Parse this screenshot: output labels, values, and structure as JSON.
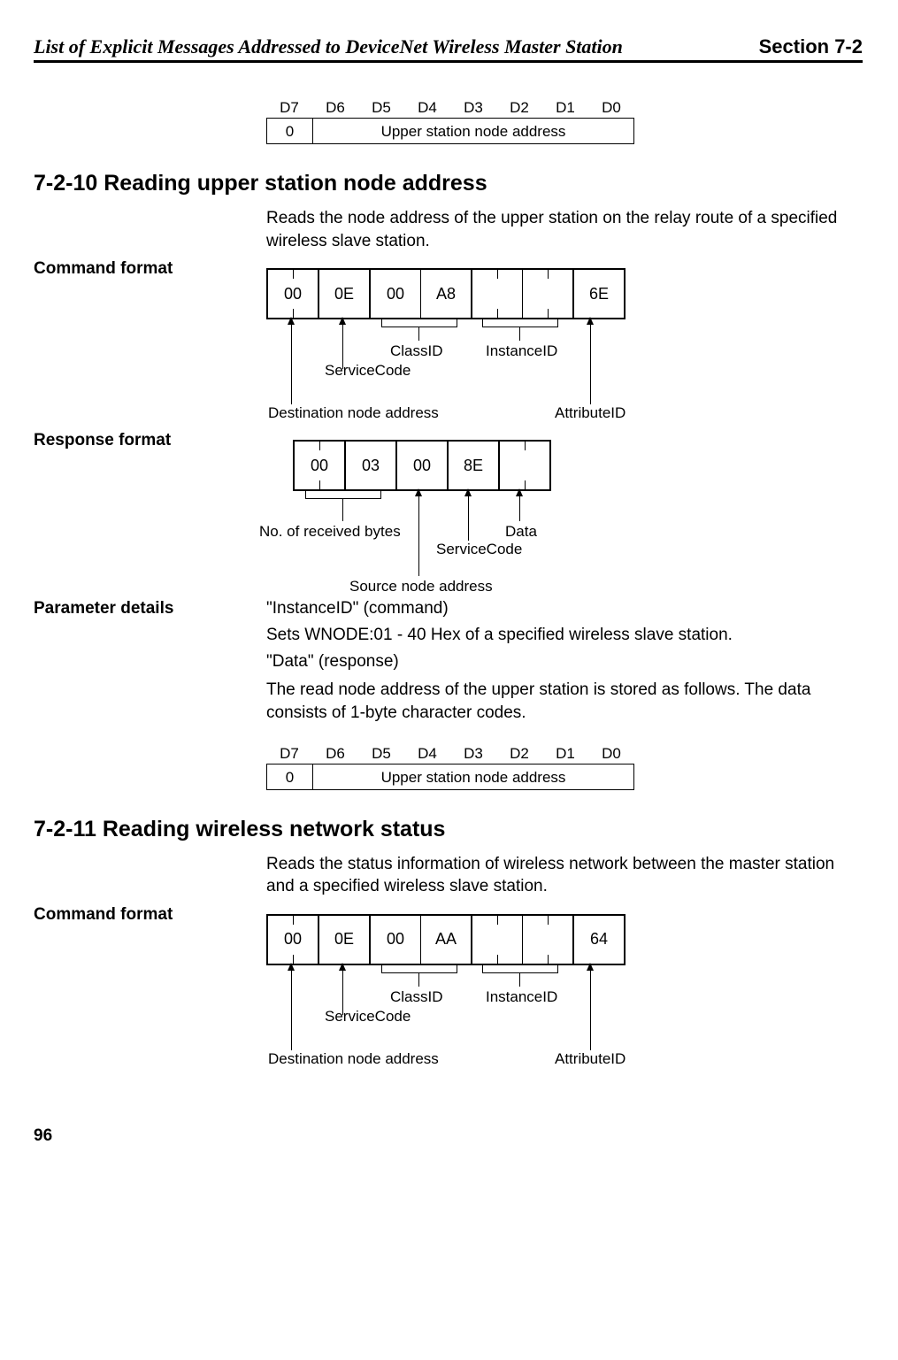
{
  "header": {
    "title": "List of Explicit Messages Addressed to DeviceNet Wireless Master Station",
    "section": "Section 7-2"
  },
  "bits": {
    "labels": [
      "D7",
      "D6",
      "D5",
      "D4",
      "D3",
      "D2",
      "D1",
      "D0"
    ],
    "zero": "0",
    "upper": "Upper station node address"
  },
  "sec10": {
    "heading": "7-2-10   Reading upper station node address",
    "intro": "Reads the node address of the upper station on the relay route of a specified wireless slave station.",
    "cmd_label": "Command format",
    "cmd_cells": [
      "00",
      "0E",
      "00",
      "A8",
      "",
      "",
      "6E"
    ],
    "cmd_lbls": {
      "dest": "Destination node address",
      "svc": "ServiceCode",
      "cls": "ClassID",
      "inst": "InstanceID",
      "attr": "AttributeID"
    },
    "resp_label": "Response format",
    "resp_cells": [
      "00",
      "03",
      "00",
      "8E",
      ""
    ],
    "resp_lbls": {
      "recv": "No. of received bytes",
      "src": "Source node address",
      "svc": "ServiceCode",
      "data": "Data"
    },
    "param_label": "Parameter details",
    "param_lines": [
      "\"InstanceID\" (command)",
      "Sets WNODE:01 - 40 Hex of a specified wireless slave station.",
      "\"Data\" (response)",
      "The read node address of the upper station is stored as follows. The data consists of 1-byte character codes."
    ]
  },
  "sec11": {
    "heading": "7-2-11   Reading wireless network status",
    "intro": "Reads the status information of wireless network between the master station and a specified wireless slave station.",
    "cmd_label": "Command format",
    "cmd_cells": [
      "00",
      "0E",
      "00",
      "AA",
      "",
      "",
      "64"
    ],
    "cmd_lbls": {
      "dest": "Destination node address",
      "svc": "ServiceCode",
      "cls": "ClassID",
      "inst": "InstanceID",
      "attr": "AttributeID"
    }
  },
  "page_num": "96"
}
